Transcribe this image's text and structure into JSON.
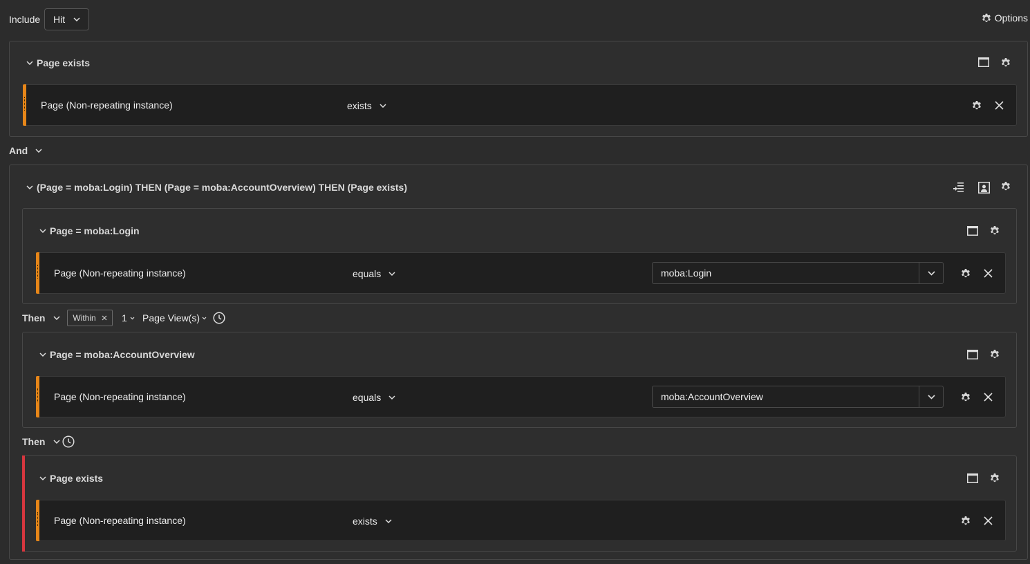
{
  "topbar": {
    "include_label": "Include",
    "include_value": "Hit",
    "options_label": "Options"
  },
  "container1": {
    "title": "Page exists",
    "rule": {
      "dimension": "Page (Non-repeating instance)",
      "operator": "exists"
    }
  },
  "logic_operator": "And",
  "sequence": {
    "title": "(Page = moba:Login) THEN (Page = moba:AccountOverview) THEN (Page exists)",
    "step1": {
      "title": "Page = moba:Login",
      "rule": {
        "dimension": "Page (Non-repeating instance)",
        "operator": "equals",
        "value": "moba:Login"
      }
    },
    "then1": {
      "label": "Then",
      "within_label": "Within",
      "count": "1",
      "unit": "Page View(s)"
    },
    "step2": {
      "title": "Page = moba:AccountOverview",
      "rule": {
        "dimension": "Page (Non-repeating instance)",
        "operator": "equals",
        "value": "moba:AccountOverview"
      }
    },
    "then2": {
      "label": "Then"
    },
    "step3": {
      "title": "Page exists",
      "rule": {
        "dimension": "Page (Non-repeating instance)",
        "operator": "exists"
      }
    }
  },
  "colors": {
    "background": "#2c2c2c",
    "rule_accent": "#e68619",
    "exclude_accent": "#d7373f"
  }
}
